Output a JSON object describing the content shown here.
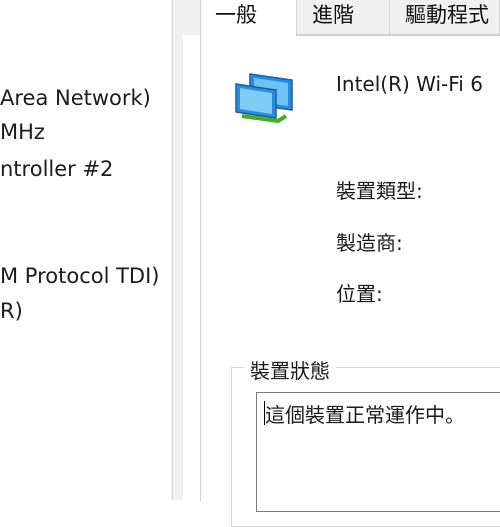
{
  "device_list": {
    "items": [
      "Area Network)",
      "MHz",
      "ntroller #2",
      "M Protocol TDI)",
      "R)"
    ]
  },
  "dialog": {
    "tabs": [
      {
        "label": "一般",
        "active": true
      },
      {
        "label": "進階",
        "active": false
      },
      {
        "label": "驅動程式",
        "active": false
      }
    ],
    "device_name": "Intel(R) Wi-Fi 6",
    "device_icon": "network-adapter-icon",
    "properties": {
      "type_label": "裝置類型:",
      "manufacturer_label": "製造商:",
      "location_label": "位置:"
    },
    "device_status": {
      "title": "裝置狀態",
      "text": "這個裝置正常運作中。"
    }
  }
}
